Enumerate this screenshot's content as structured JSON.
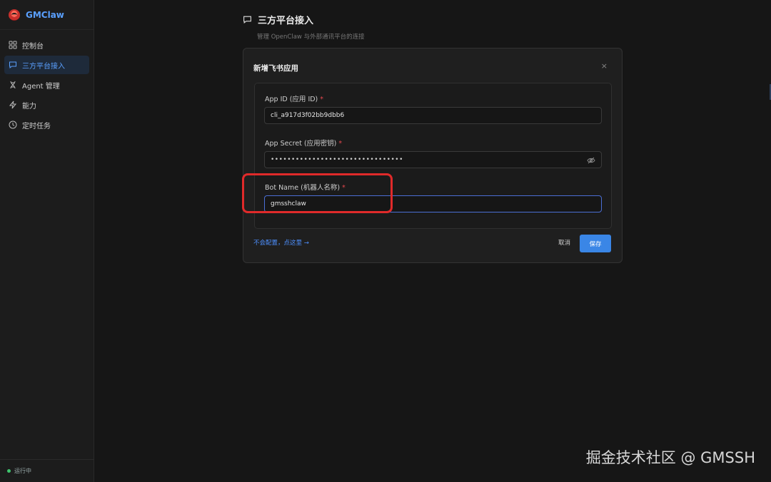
{
  "brand": {
    "name": "GMClaw"
  },
  "sidebar": {
    "items": [
      {
        "label": "控制台",
        "icon": "grid-icon"
      },
      {
        "label": "三方平台接入",
        "icon": "chat-icon",
        "active": true
      },
      {
        "label": "Agent 管理",
        "icon": "dna-icon"
      },
      {
        "label": "能力",
        "icon": "lightning-icon"
      },
      {
        "label": "定时任务",
        "icon": "clock-icon"
      }
    ],
    "status": "运行中"
  },
  "header": {
    "title": "三方平台接入",
    "subtitle": "管理 OpenClaw 与外部通讯平台的连接"
  },
  "dialog": {
    "title": "新增飞书应用",
    "close": "×",
    "fields": [
      {
        "label": "App ID (应用 ID)",
        "required": "*",
        "value": "cli_a917d3f02bb9dbb6"
      },
      {
        "label": "App Secret (应用密钥)",
        "required": "*",
        "value": "••••••••••••••••••••••••••••••••"
      },
      {
        "label": "Bot Name (机器人名称)",
        "required": "*",
        "value": "gmsshclaw"
      }
    ],
    "help_link": "不会配置，点这里 →",
    "cancel_label": "取消",
    "save_label": "保存"
  },
  "watermark": "掘金技术社区 @ GMSSH",
  "colors": {
    "accent": "#3a86e6",
    "highlight": "#e02a2a",
    "status_ok": "#3ec46d"
  }
}
